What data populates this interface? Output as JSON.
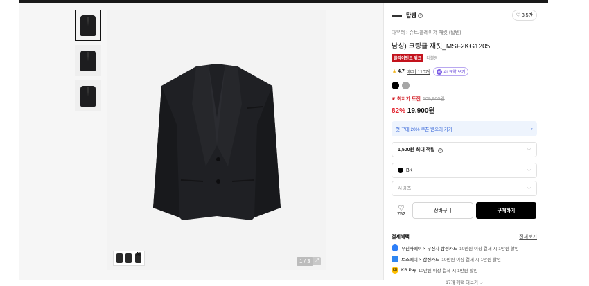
{
  "gallery": {
    "counter": "1 / 3",
    "mini_label": "AI"
  },
  "product": {
    "brand": "탑텐",
    "likes": "3.5만",
    "breadcrumb": "아우터 › 슈트/블레이저 재킷 (탑텐)",
    "title": "남성) 크링클 재킷_MSF2KG1205",
    "badge": "클라이언트 위크",
    "badge_sub": "더블랑",
    "rating": "4.7",
    "reviews": "후기 110개",
    "ai_label": "AI 요약 보기",
    "ai_icon": "AI",
    "colors": [
      "#000000",
      "#a6a6a6"
    ],
    "promo_label": "최저가 도전",
    "original_price": "109,900원",
    "discount": "82%",
    "price": "19,900원",
    "coupon_text": "첫 구매 20% 쿠폰 받으러 가기",
    "points_text": "1,500원 최대 적립",
    "selected_color": "BK",
    "size_placeholder": "사이즈",
    "wish_count": "752",
    "cart_label": "장바구니",
    "buy_label": "구매하기"
  },
  "benefits": {
    "title": "결제혜택",
    "all_label": "전체보기",
    "items": [
      {
        "icon": "pay",
        "name": "무신사페이 × 무신사 삼성카드",
        "desc": "10만원 이상 결제 시 1만원 할인"
      },
      {
        "icon": "toss",
        "name": "토스페이 × 삼성카드",
        "desc": "10만원 이상 결제 시 1만원 할인"
      },
      {
        "icon": "KB",
        "name": "KB Pay",
        "desc": "10만원 이상 결제 시 1만원 할인"
      }
    ],
    "more_label": "17개 혜택 더보기 ⌵"
  }
}
